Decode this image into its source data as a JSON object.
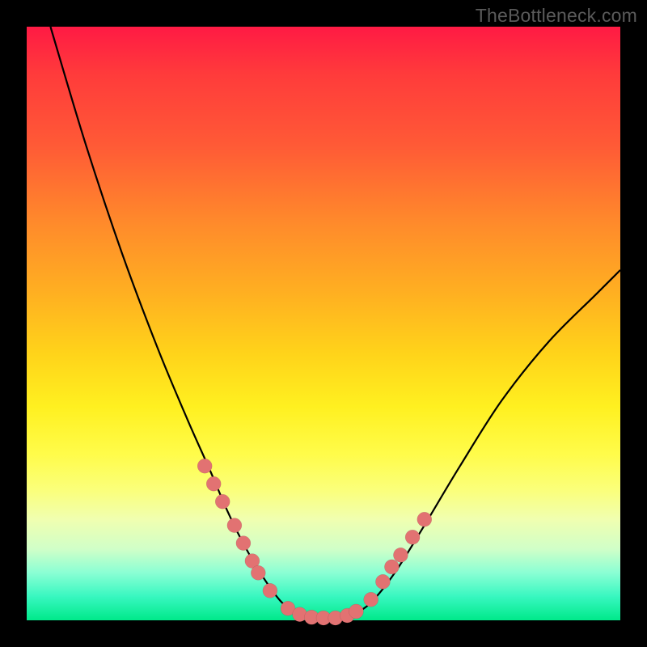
{
  "watermark": "TheBottleneck.com",
  "chart_data": {
    "type": "line",
    "title": "",
    "xlabel": "",
    "ylabel": "",
    "xlim": [
      0,
      100
    ],
    "ylim": [
      0,
      100
    ],
    "legend": false,
    "grid": false,
    "background_gradient": [
      "#ff1a44",
      "#ffd31a",
      "#00e98a"
    ],
    "series": [
      {
        "name": "curve",
        "x": [
          4,
          10,
          16,
          22,
          27,
          31,
          34,
          37,
          40,
          43,
          46,
          49,
          52,
          55,
          58,
          62,
          67,
          73,
          80,
          88,
          96,
          100
        ],
        "y": [
          100,
          80,
          62,
          46,
          34,
          25,
          18,
          12,
          7,
          3,
          1,
          0,
          0,
          1,
          3,
          8,
          16,
          26,
          37,
          47,
          55,
          59
        ]
      }
    ],
    "markers": {
      "name": "highlight-dots",
      "x": [
        30,
        31.5,
        33,
        35,
        36.5,
        38,
        39,
        41,
        44,
        46,
        48,
        50,
        52,
        54,
        55.5,
        58,
        60,
        61.5,
        63,
        65,
        67
      ],
      "y": [
        26,
        23,
        20,
        16,
        13,
        10,
        8,
        5,
        2,
        1,
        0.5,
        0.4,
        0.4,
        0.8,
        1.5,
        3.5,
        6.5,
        9,
        11,
        14,
        17
      ]
    }
  }
}
